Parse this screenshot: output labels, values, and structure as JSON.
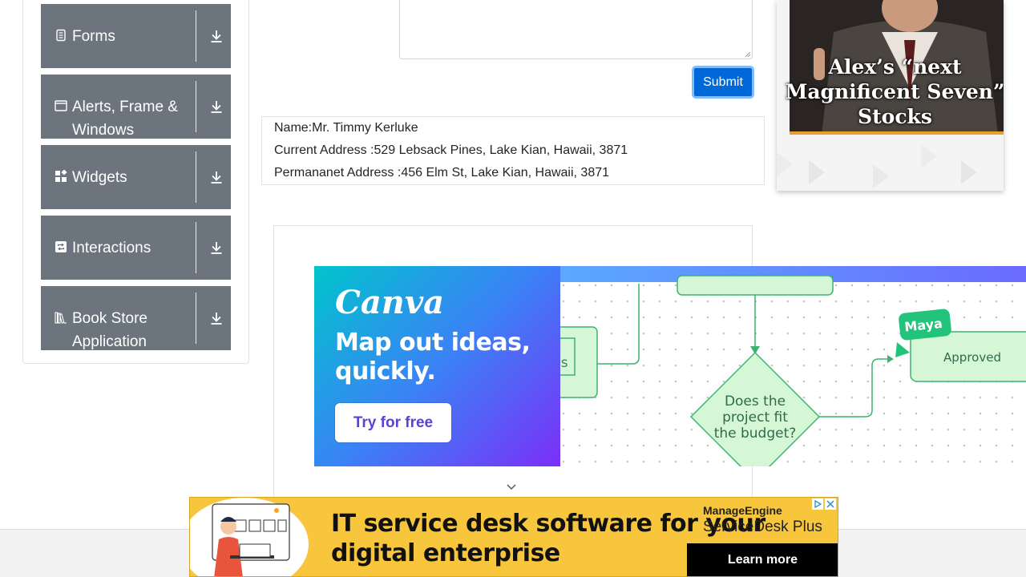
{
  "sidebar": {
    "groups": [
      {
        "label": "Forms",
        "icon": "form-icon"
      },
      {
        "label": "Alerts, Frame & Windows",
        "icon": "window-icon"
      },
      {
        "label": "Widgets",
        "icon": "widgets-icon"
      },
      {
        "label": "Interactions",
        "icon": "interactions-icon"
      },
      {
        "label": "Book Store Application",
        "icon": "books-icon"
      }
    ]
  },
  "form": {
    "submit_label": "Submit"
  },
  "output": {
    "name": "Name:Mr. Timmy Kerluke",
    "current_address": "Current Address :529 Lebsack Pines, Lake Kian, Hawaii, 3871",
    "permanent_address": "Permananet Address :456 Elm St, Lake Kian, Hawaii, 3871"
  },
  "ads": {
    "right": {
      "headline": "Alex’s “next Magnificent Seven” Stocks"
    },
    "canva": {
      "logo": "Canva",
      "headline": "Map out ideas, quickly.",
      "cta": "Try for free",
      "diagram": {
        "node_maya": "Maya",
        "node_approved": "Approved",
        "node_partial": "ds",
        "decision": "Does the project fit the budget?"
      }
    },
    "bottom": {
      "headline": "IT service desk software for your digital enterprise",
      "brand_small": "ManageEngine",
      "brand_big": "ServiceDesk Plus",
      "cta": "Learn more"
    }
  },
  "colors": {
    "sidebar_header": "#6c757d",
    "submit": "#0069d9",
    "bottom_ad": "#f8c63d",
    "canva_gradient_start": "#00c4cc",
    "canva_gradient_end": "#7b2ff7"
  }
}
